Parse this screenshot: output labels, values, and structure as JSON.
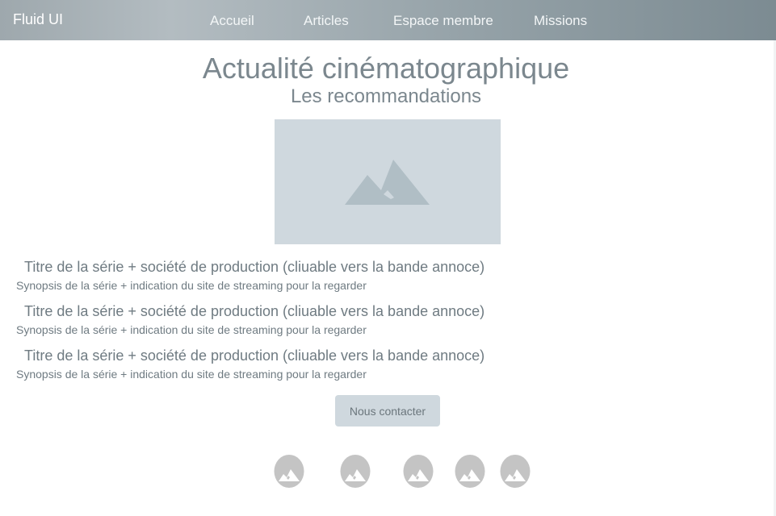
{
  "header": {
    "brand": "Fluid UI",
    "nav": {
      "home": "Accueil",
      "articles": "Articles",
      "member_area": "Espace membre",
      "missions": "Missions"
    }
  },
  "main": {
    "title": "Actualité cinématographique",
    "subtitle": "Les recommandations",
    "hero_icon": "image-placeholder-icon",
    "items": [
      {
        "title": "Titre de la série + société de production (cliuable vers la bande annoce)",
        "description": "Synopsis de la série + indication du site de streaming pour la regarder"
      },
      {
        "title": "Titre de la série + société de production (cliuable vers la bande annoce)",
        "description": "Synopsis de la série + indication du site de streaming pour la regarder"
      },
      {
        "title": "Titre de la série + société de production (cliuable vers la bande annoce)",
        "description": "Synopsis de la série + indication du site de streaming pour la regarder"
      }
    ],
    "contact_button": "Nous contacter"
  },
  "footer": {
    "icons": [
      "image-placeholder-icon",
      "image-placeholder-icon",
      "image-placeholder-icon",
      "image-placeholder-icon",
      "image-placeholder-icon"
    ]
  },
  "colors": {
    "header_gradient_start": "#9ea8ad",
    "header_gradient_end": "#7c8b92",
    "text": "#7b878e",
    "placeholder_bg": "#cfd8de",
    "placeholder_mountain": "#b0bec5",
    "round_icon_bg": "#c4c4c4"
  }
}
